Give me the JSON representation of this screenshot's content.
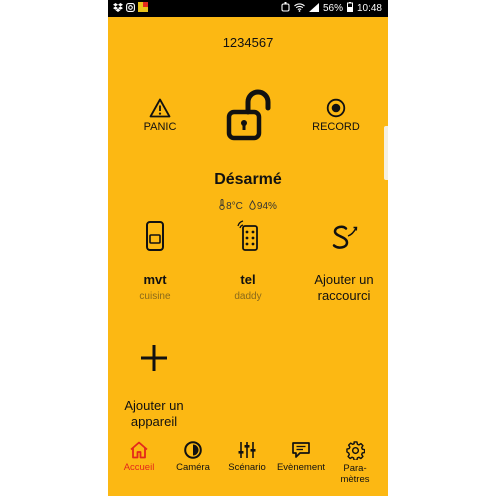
{
  "status_bar": {
    "battery": "56%",
    "time": "10:48"
  },
  "header": {
    "code": "1234567"
  },
  "quick_actions": {
    "panic_label": "PANIC",
    "record_label": "RECORD"
  },
  "system": {
    "state": "Désarmé",
    "temperature": "8°C",
    "humidity": "94%"
  },
  "devices": [
    {
      "name": "mvt",
      "location": "cuisine"
    },
    {
      "name": "tel",
      "location": "daddy"
    }
  ],
  "shortcut": {
    "label_line1": "Ajouter un",
    "label_line2": "raccourci"
  },
  "add_device": {
    "label_line1": "Ajouter un",
    "label_line2": "appareil"
  },
  "bottom_nav": {
    "items": [
      {
        "label": "Accueil",
        "icon": "home-icon",
        "active": true
      },
      {
        "label": "Caméra",
        "icon": "camera-icon",
        "active": false
      },
      {
        "label": "Scénario",
        "icon": "sliders-icon",
        "active": false
      },
      {
        "label": "Evènement",
        "icon": "chat-icon",
        "active": false
      },
      {
        "label_line1": "Para-",
        "label_line2": "mètres",
        "icon": "gear-icon",
        "active": false
      }
    ]
  },
  "colors": {
    "background": "#fcb813",
    "active_nav": "#e3281c",
    "text": "#111111",
    "secondary_text": "#8a6a1a"
  }
}
